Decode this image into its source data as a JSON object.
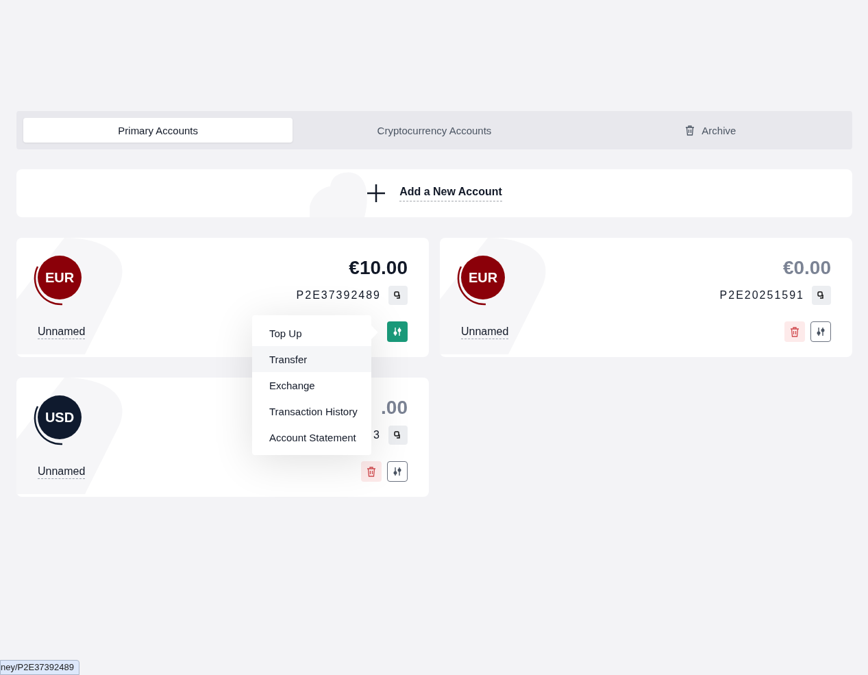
{
  "tabs": [
    {
      "label": "Primary Accounts",
      "selected": true,
      "kind": "plain"
    },
    {
      "label": "Cryptocurrency Accounts",
      "selected": false,
      "kind": "plain"
    },
    {
      "label": "Archive",
      "selected": false,
      "kind": "archive"
    }
  ],
  "add_account": {
    "label": "Add a New Account"
  },
  "accounts": [
    {
      "currency": "EUR",
      "color": "#8b0009",
      "balance": "€10.00",
      "muted": false,
      "account_number": "P2E37392489",
      "name": "Unnamed",
      "menu_open": true,
      "show_delete": false,
      "menu": [
        {
          "label": "Top Up",
          "highlighted": false
        },
        {
          "label": "Transfer",
          "highlighted": true
        },
        {
          "label": "Exchange",
          "highlighted": false
        },
        {
          "label": "Transaction History",
          "highlighted": false
        },
        {
          "label": "Account Statement",
          "highlighted": false
        }
      ]
    },
    {
      "currency": "EUR",
      "color": "#8b0009",
      "balance": "€0.00",
      "muted": true,
      "account_number": "P2E20251591",
      "name": "Unnamed",
      "menu_open": false,
      "show_delete": true
    },
    {
      "currency": "USD",
      "color": "#0f1a2e",
      "balance": ".00",
      "muted": true,
      "account_number": "3",
      "name": "Unnamed",
      "menu_open": false,
      "show_delete": true
    }
  ],
  "status_url": "ney/P2E37392489"
}
